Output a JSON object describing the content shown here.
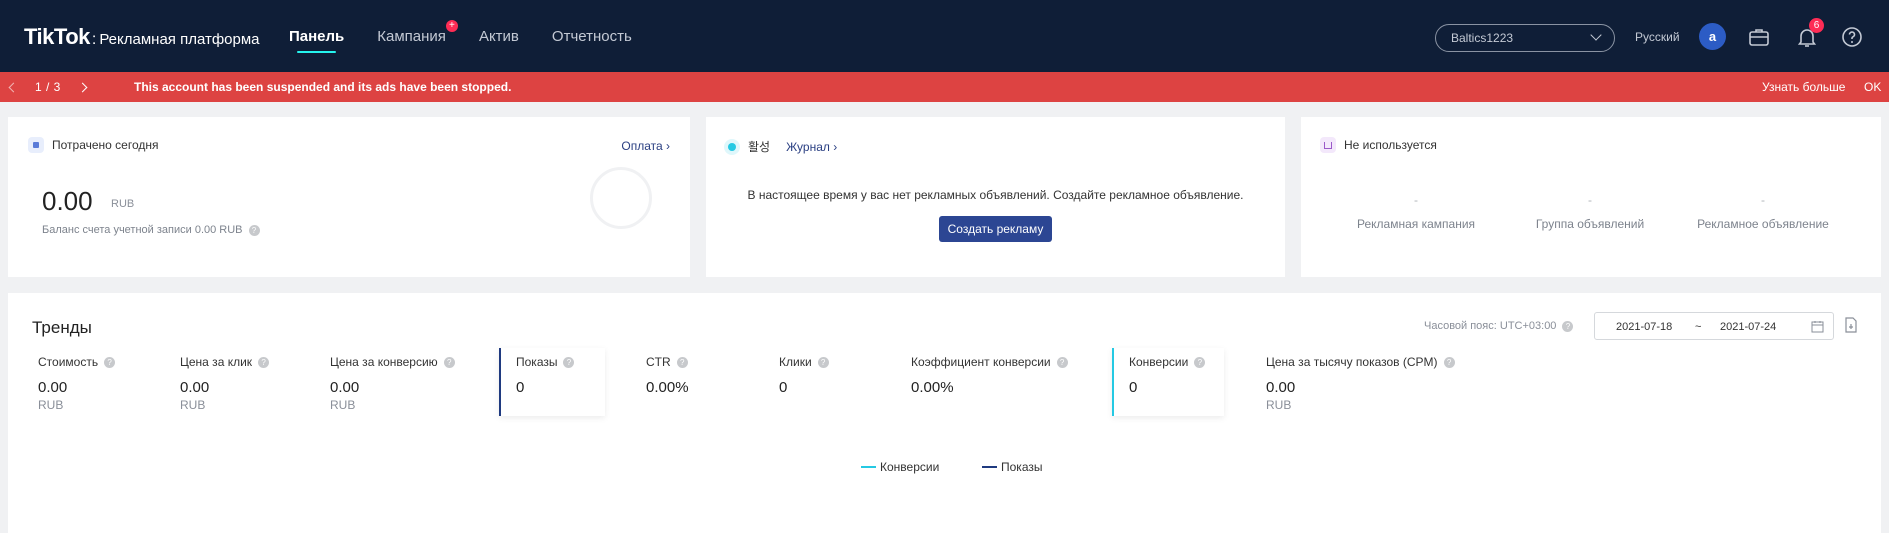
{
  "header": {
    "logo": "TikTok",
    "logo_sep": ":",
    "subtitle": "Рекламная платформа",
    "nav": [
      {
        "label": "Панель"
      },
      {
        "label": "Кампания",
        "badge": "+"
      },
      {
        "label": "Актив"
      },
      {
        "label": "Отчетность"
      }
    ],
    "account": "Baltics1223",
    "language": "Русский",
    "avatar_letter": "a",
    "notifications_count": "6"
  },
  "alert": {
    "page": "1  /  3",
    "message": "This account has been suspended and its ads have been stopped.",
    "more": "Узнать больше",
    "ok": "OK"
  },
  "spent_card": {
    "title": "Потрачено сегодня",
    "link": "Оплата",
    "value": "0.00",
    "unit": "RUB",
    "balance": "Баланс счета учетной записи 0.00 RUB"
  },
  "status_card": {
    "status": "활성",
    "journal": "Журнал",
    "empty_message": "В настоящее время у вас нет рекламных объявлений. Создайте рекламное объявление.",
    "create_button": "Создать рекламу"
  },
  "unused_card": {
    "title": "Не используется",
    "columns": [
      {
        "value": "-",
        "label": "Рекламная кампания"
      },
      {
        "value": "-",
        "label": "Группа объявлений"
      },
      {
        "value": "-",
        "label": "Рекламное объявление"
      }
    ]
  },
  "trends": {
    "title": "Тренды",
    "timezone": "Часовой пояс: UTC+03:00",
    "date_start": "2021-07-18",
    "date_sep": "~",
    "date_end": "2021-07-24",
    "metrics": [
      {
        "label": "Стоимость",
        "value": "0.00",
        "unit": "RUB"
      },
      {
        "label": "Цена за клик",
        "value": "0.00",
        "unit": "RUB"
      },
      {
        "label": "Цена за конверсию",
        "value": "0.00",
        "unit": "RUB"
      },
      {
        "label": "Показы",
        "value": "0",
        "unit": ""
      },
      {
        "label": "CTR",
        "value": "0.00%",
        "unit": ""
      },
      {
        "label": "Клики",
        "value": "0",
        "unit": ""
      },
      {
        "label": "Коэффициент конверсии",
        "value": "0.00%",
        "unit": ""
      },
      {
        "label": "Конверсии",
        "value": "0",
        "unit": ""
      },
      {
        "label": "Цена за тысячу показов (CPM)",
        "value": "0.00",
        "unit": "RUB"
      }
    ],
    "legend": [
      {
        "label": "Конверсии",
        "color": "#25c9e3"
      },
      {
        "label": "Показы",
        "color": "#1f3a80"
      }
    ]
  },
  "colors": {
    "nav_bg": "#0f1e37",
    "alert_bg": "#dd4342",
    "primary": "#2c4693",
    "accent": "#25f4ee"
  }
}
